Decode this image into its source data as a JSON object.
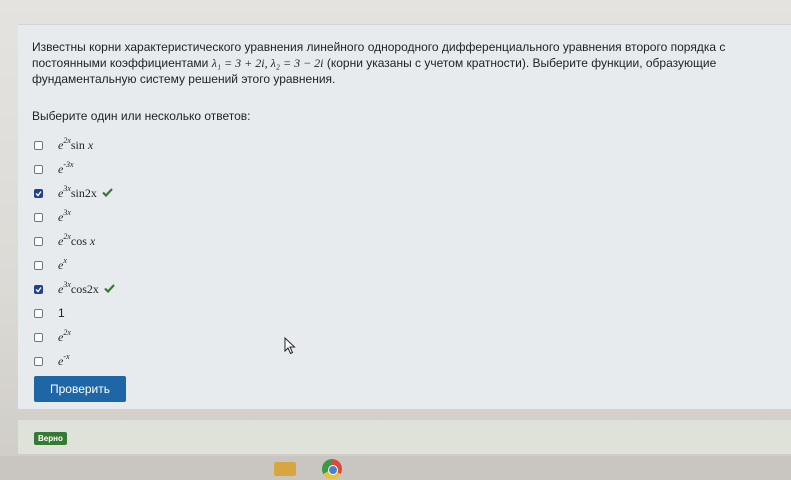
{
  "question": {
    "part1": "Известны корни характеристического уравнения линейного однородного дифференциального уравнения второго порядка с постоянными коэффициентами ",
    "lambda1": "λ₁ = 3 + 2i, λ₂ = 3 − 2i",
    "part2": " (корни указаны с учетом кратности). Выберите функции, образующие фундаментальную систему решений этого уравнения."
  },
  "prompt": "Выберите один или несколько ответов:",
  "options": [
    {
      "base": "e",
      "exp": "2x",
      "fn": "sin",
      "arg": " x",
      "checked": false,
      "correct": false
    },
    {
      "base": "e",
      "exp": "-3x",
      "fn": "",
      "arg": "",
      "checked": false,
      "correct": false
    },
    {
      "base": "e",
      "exp": "3x",
      "fn": "sin",
      "arg": "2x",
      "checked": true,
      "correct": true
    },
    {
      "base": "e",
      "exp": "3x",
      "fn": "",
      "arg": "",
      "checked": false,
      "correct": false
    },
    {
      "base": "e",
      "exp": "2x",
      "fn": "cos",
      "arg": " x",
      "checked": false,
      "correct": false
    },
    {
      "base": "e",
      "exp": "x",
      "fn": "",
      "arg": "",
      "checked": false,
      "correct": false
    },
    {
      "base": "e",
      "exp": "3x",
      "fn": "cos",
      "arg": "2x",
      "checked": true,
      "correct": true
    },
    {
      "plain": "1",
      "checked": false,
      "correct": false
    },
    {
      "base": "e",
      "exp": "2x",
      "fn": "",
      "arg": "",
      "checked": false,
      "correct": false
    },
    {
      "base": "e",
      "exp": "-x",
      "fn": "",
      "arg": "",
      "checked": false,
      "correct": false
    }
  ],
  "check_button": "Проверить",
  "feedback_badge": "Верно",
  "colors": {
    "primary": "#1f66a6",
    "checkbox_checked": "#1f3f98",
    "correct_green": "#357a32"
  },
  "icons": [
    "check-icon",
    "mouse-cursor-icon",
    "folder-icon",
    "chrome-icon"
  ]
}
